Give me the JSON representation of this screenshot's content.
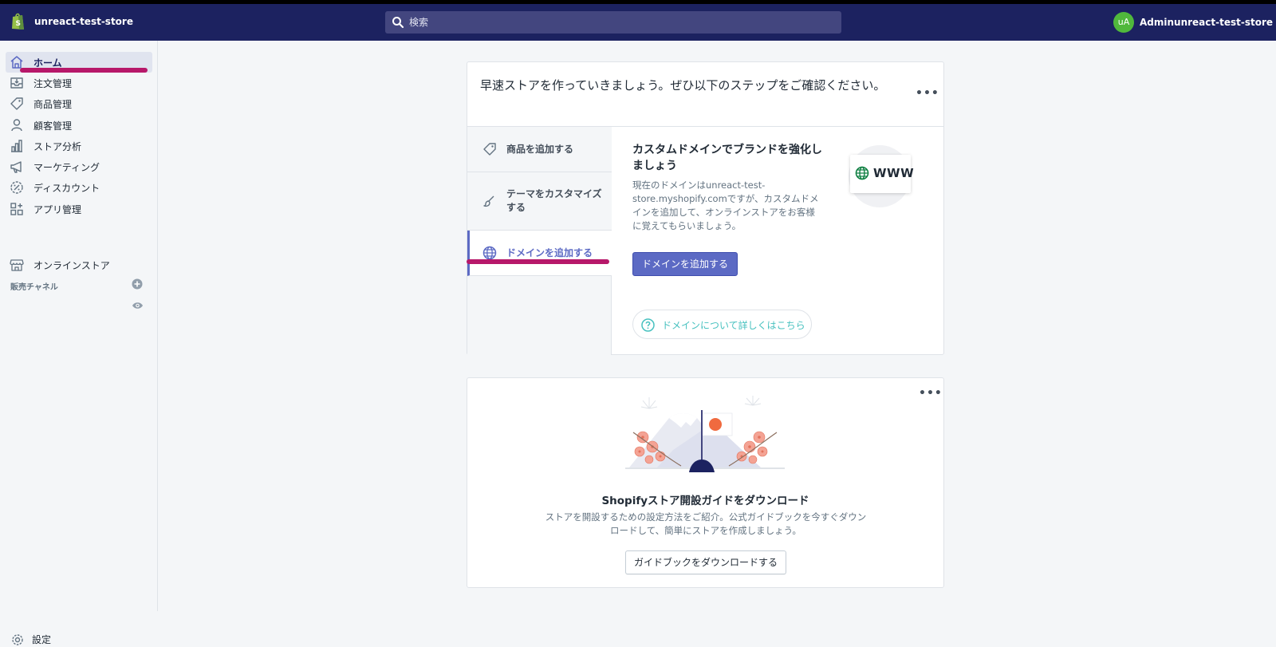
{
  "topbar": {
    "store_name": "unreact-test-store",
    "search_placeholder": "検索",
    "avatar_initials": "uA",
    "account_name": "Adminunreact-test-store"
  },
  "sidebar": {
    "items": [
      {
        "label": "ホーム",
        "icon": "home-icon"
      },
      {
        "label": "注文管理",
        "icon": "orders-icon"
      },
      {
        "label": "商品管理",
        "icon": "tag-icon"
      },
      {
        "label": "顧客管理",
        "icon": "person-icon"
      },
      {
        "label": "ストア分析",
        "icon": "bar-chart-icon"
      },
      {
        "label": "マーケティング",
        "icon": "megaphone-icon"
      },
      {
        "label": "ディスカウント",
        "icon": "discount-icon"
      },
      {
        "label": "アプリ管理",
        "icon": "apps-icon"
      }
    ],
    "channels_header": "販売チャネル",
    "online_store_label": "オンラインストア",
    "settings_label": "設定"
  },
  "setup_card": {
    "header": "早速ストアを作っていきましょう。ぜひ以下のステップをご確認ください。",
    "more": "•••",
    "steps": [
      {
        "label": "商品を追加する",
        "icon": "tag-icon"
      },
      {
        "label": "テーマをカスタマイズする",
        "icon": "brush-icon"
      },
      {
        "label": "ドメインを追加する",
        "icon": "globe-icon"
      }
    ],
    "detail_title": "カスタムドメインでブランドを強化しましょう",
    "detail_text": "現在のドメインはunreact-test-store.myshopify.comですが、カスタムドメインを追加して、オンラインストアをお客様に覚えてもらいましょう。",
    "www_label": "WWW",
    "primary_button": "ドメインを追加する",
    "help_link": "ドメインについて詳しくはこちら"
  },
  "guide_card": {
    "more": "•••",
    "title": "Shopifyストア開設ガイドをダウンロード",
    "text": "ストアを開設するための設定方法をご紹介。公式ガイドブックを今すぐダウンロードして、簡単にストアを作成しましょう。",
    "button": "ガイドブックをダウンロードする"
  },
  "colors": {
    "topbar": "#1c2260",
    "accent": "#5c6ac4",
    "annotation_underline": "#b7186a",
    "avatar": "#50b83c"
  }
}
